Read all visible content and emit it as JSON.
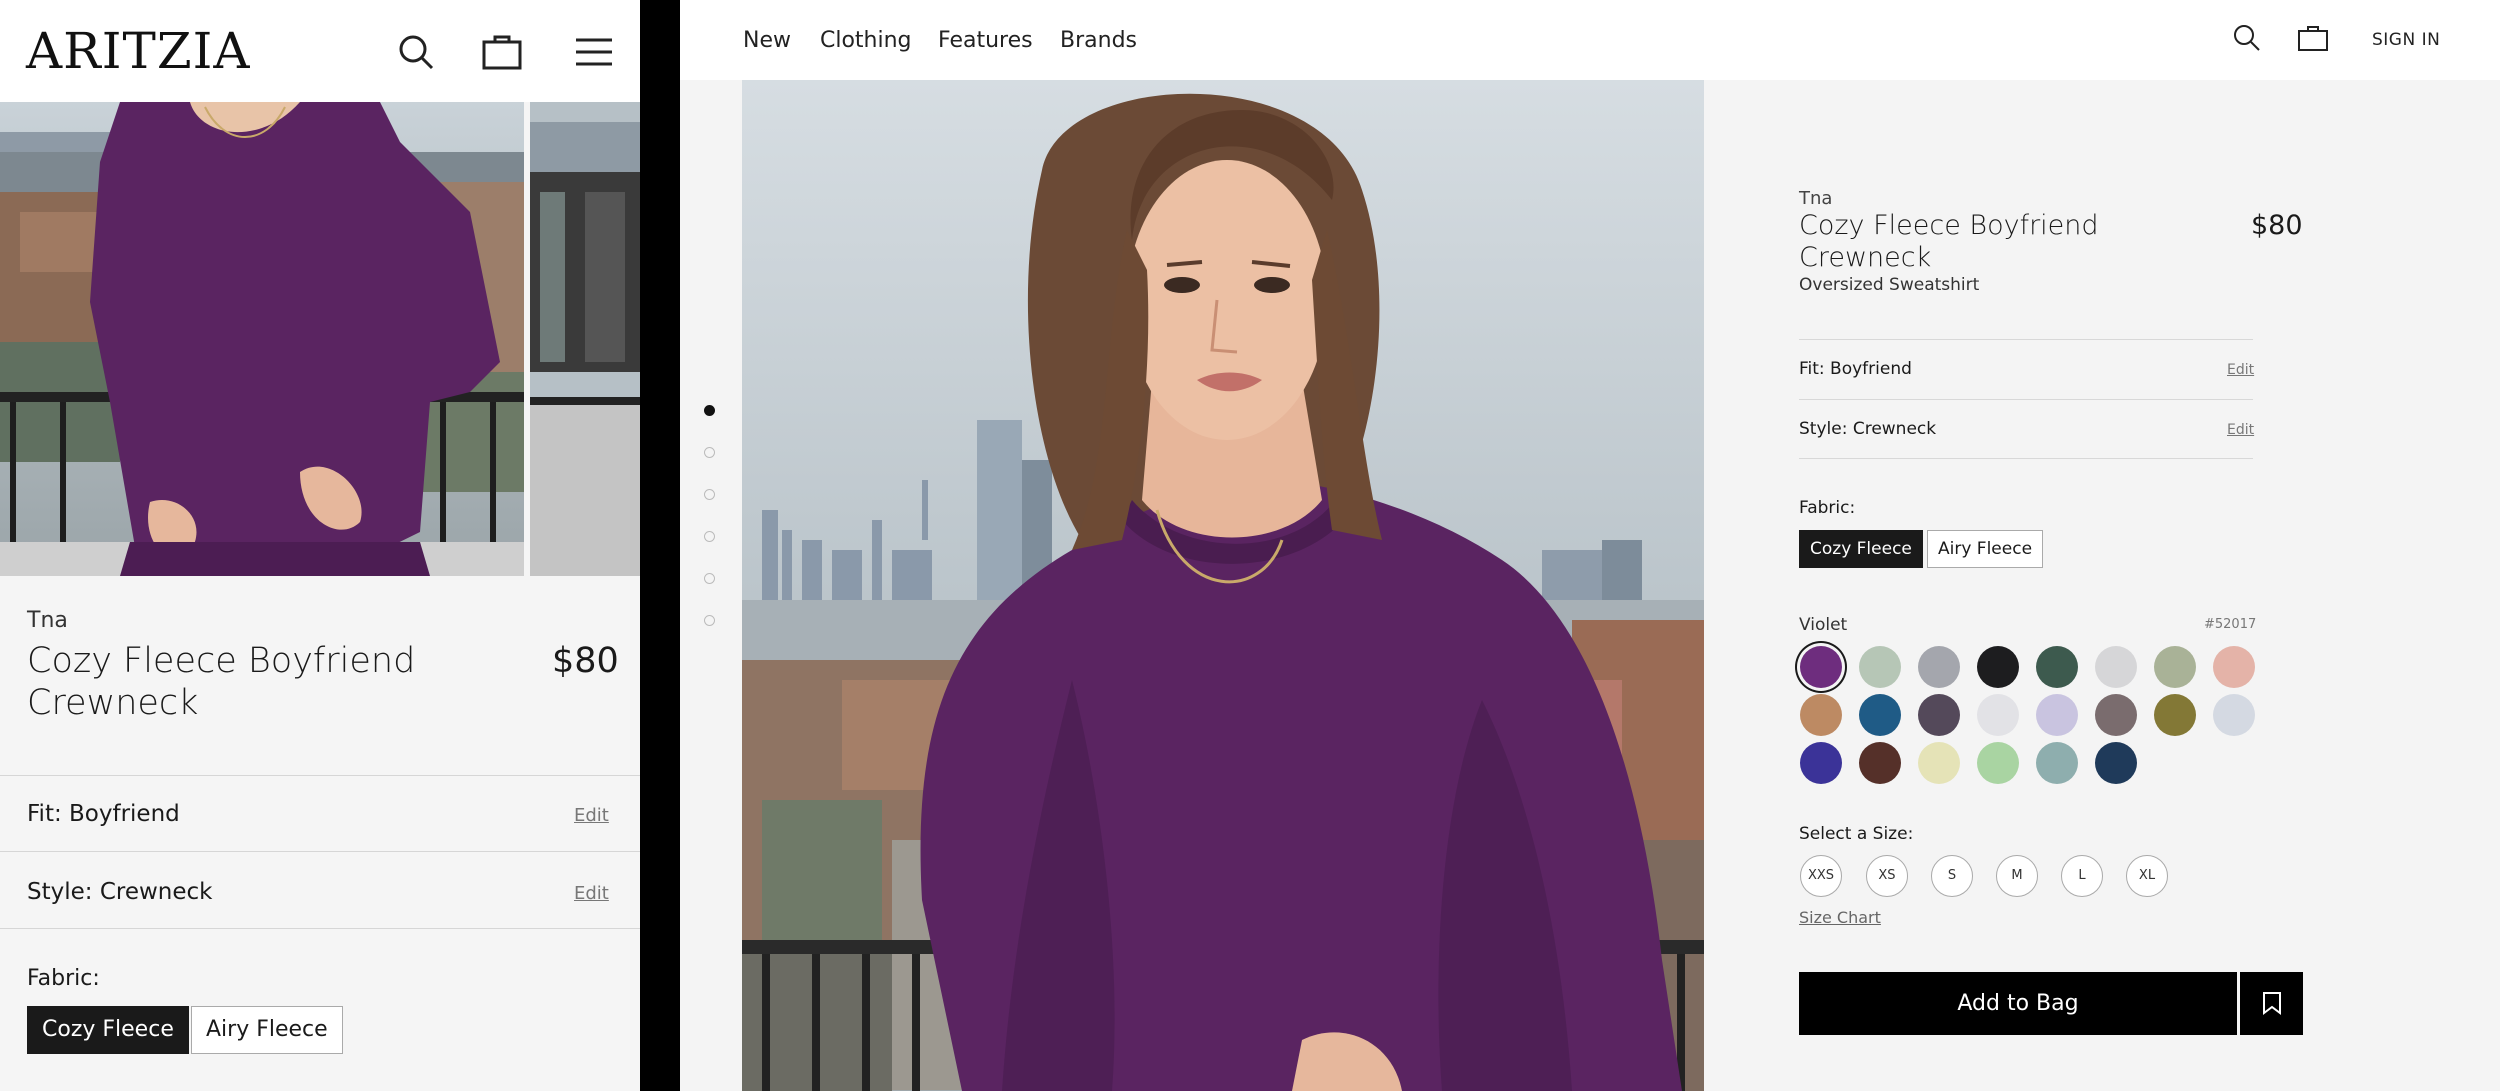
{
  "mobile": {
    "logo": "ARITZIA",
    "header_icons": [
      "search-icon",
      "bag-icon",
      "menu-icon"
    ],
    "product": {
      "brand": "Tna",
      "title": "Cozy Fleece Boyfriend Crewneck",
      "price": "$80"
    },
    "options": [
      {
        "label": "Fit: Boyfriend",
        "edit": "Edit"
      },
      {
        "label": "Style: Crewneck",
        "edit": "Edit"
      }
    ],
    "fabric": {
      "label": "Fabric:",
      "choices": [
        "Cozy Fleece",
        "Airy Fleece"
      ],
      "selected": "Cozy Fleece"
    }
  },
  "desktop": {
    "nav": [
      "New",
      "Clothing",
      "Features",
      "Brands"
    ],
    "header_icons": [
      "search-icon",
      "bag-icon"
    ],
    "sign_in": "SIGN IN",
    "gallery": {
      "image_count": 6,
      "active_index": 0
    },
    "product": {
      "brand": "Tna",
      "title": "Cozy Fleece Boyfriend Crewneck",
      "price": "$80",
      "subtitle": "Oversized Sweatshirt"
    },
    "options": [
      {
        "label": "Fit: Boyfriend",
        "edit": "Edit"
      },
      {
        "label": "Style: Crewneck",
        "edit": "Edit"
      }
    ],
    "fabric": {
      "label": "Fabric:",
      "choices": [
        "Cozy Fleece",
        "Airy Fleece"
      ],
      "selected": "Cozy Fleece"
    },
    "color": {
      "selected_name": "Violet",
      "selected_code": "#52017",
      "swatches": [
        "#6e2d7e",
        "#b6c6b6",
        "#a4a6ad",
        "#1d1d1f",
        "#3d5a4e",
        "#d6d6d8",
        "#a9b297",
        "#e4b3a8",
        "#bd8a63",
        "#1f5b86",
        "#54495a",
        "#e2e2e6",
        "#c9c4e0",
        "#7a6c6e",
        "#837836",
        "#d4d9e2",
        "#3b3398",
        "#553029",
        "#e5e3b7",
        "#a9d4a2",
        "#8eaeae",
        "#1f3a5a"
      ]
    },
    "size": {
      "label": "Select a Size:",
      "options": [
        "XXS",
        "XS",
        "S",
        "M",
        "L",
        "XL"
      ],
      "chart_link": "Size Chart"
    },
    "add_to_bag": "Add to Bag",
    "wishlist_icon": "bookmark-icon"
  },
  "colors": {
    "sweatshirt": "#5a2461",
    "black": "#000000",
    "panel_bg": "#f4f4f4"
  }
}
